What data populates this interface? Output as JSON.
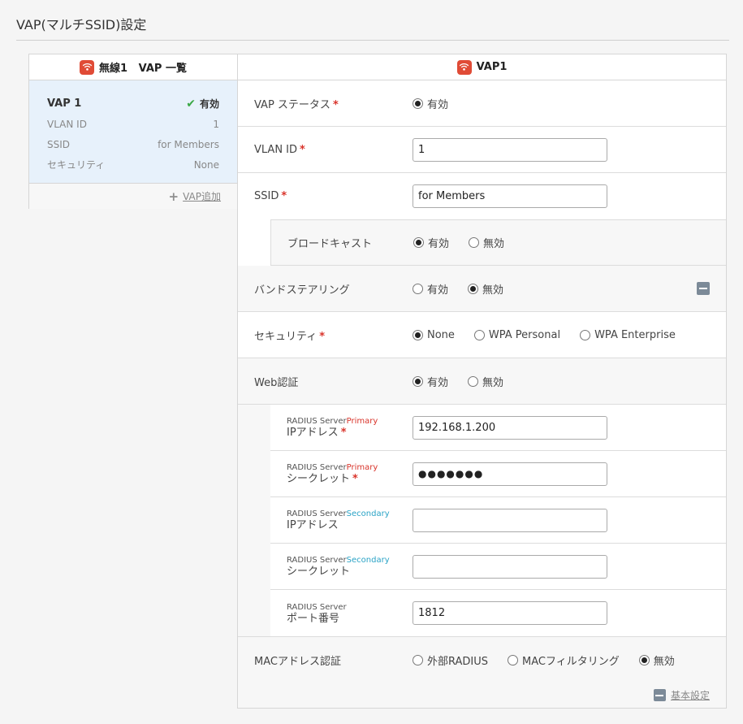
{
  "page": {
    "title": "VAP(マルチSSID)設定"
  },
  "left": {
    "header": "無線1   VAP 一覧",
    "card": {
      "name": "VAP 1",
      "status": "有効",
      "rows": [
        {
          "key": "VLAN ID",
          "value": "1"
        },
        {
          "key": "SSID",
          "value": "for Members"
        },
        {
          "key": "セキュリティ",
          "value": "None"
        }
      ]
    },
    "add_label": "VAP追加"
  },
  "right": {
    "header": "VAP1",
    "vap_status": {
      "label": "VAP ステータス",
      "opt": "有効"
    },
    "vlan": {
      "label": "VLAN ID",
      "value": "1"
    },
    "ssid": {
      "label": "SSID",
      "value": "for Members"
    },
    "broadcast": {
      "label": "ブロードキャスト",
      "opt1": "有効",
      "opt2": "無効"
    },
    "band": {
      "label": "バンドステアリング",
      "opt1": "有効",
      "opt2": "無効"
    },
    "security": {
      "label": "セキュリティ",
      "opt1": "None",
      "opt2": "WPA Personal",
      "opt3": "WPA Enterprise"
    },
    "web": {
      "label": "Web認証",
      "opt1": "有効",
      "opt2": "無効"
    },
    "radius_prefix": "RADIUS Server",
    "primary": "Primary",
    "secondary": "Secondary",
    "ip_label": "IPアドレス",
    "secret_label": "シークレット",
    "port_label": "ポート番号",
    "primary_ip": "192.168.1.200",
    "primary_secret": "●●●●●●●",
    "port": "1812",
    "mac": {
      "label": "MACアドレス認証",
      "opt1": "外部RADIUS",
      "opt2": "MACフィルタリング",
      "opt3": "無効"
    },
    "basic_label": "基本設定"
  }
}
